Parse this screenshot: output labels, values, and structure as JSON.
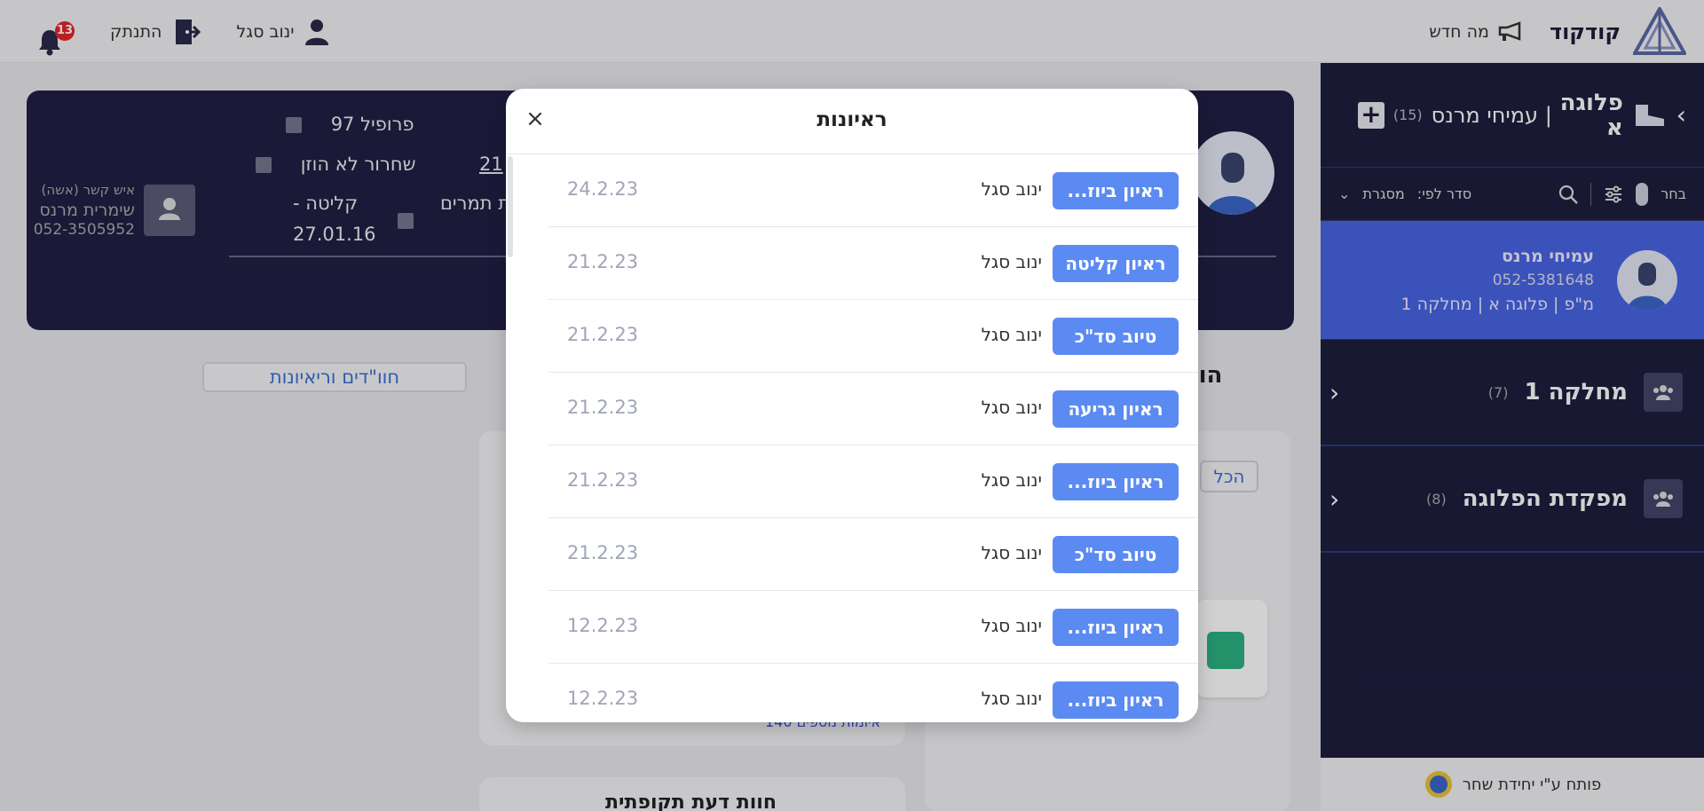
{
  "topbar": {
    "brand_name": "קודקוד",
    "whats_new": "מה חדש",
    "user_name": "ינוב סגל",
    "logout": "התנתק",
    "notifications_count": "13"
  },
  "sidebar": {
    "title": "פלוגה א",
    "separator_name": "| עמיחי מרנס",
    "count": "(15)",
    "toolbar": {
      "select": "בחר",
      "sort_by": "סדר לפי:",
      "sort_value": "מסגרת"
    },
    "selected_person": {
      "name": "עמיחי מרנס",
      "phone": "052-5381648",
      "role": "מ\"פ | פלוגה א | מחלקה 1"
    },
    "groups": [
      {
        "name": "מחלקה 1",
        "count": "(7)"
      },
      {
        "name": "מפקדת הפלוגה",
        "count": "(8)"
      }
    ],
    "footer": "פותח ע\"י יחידת שחר"
  },
  "profile_card": {
    "profile": "פרופיל 97",
    "discharge": "שחרור לא הוזן",
    "intake": "קליטה -",
    "intake_date": "27.01.16",
    "truncated_value": "21",
    "truncated_label": "ת תמרים",
    "contact_label": "איש קשר (אשה)",
    "contact_name": "שימרית מרנס",
    "contact_phone": "052-3505952"
  },
  "main": {
    "tab_label": "חוו\"דים וריאיונות",
    "heading_partial": "הודע",
    "all_filter": "הכל",
    "more_link": "140 איומות נוספים",
    "bottom_title": "חוות דעת תקופתית"
  },
  "modal": {
    "title": "ראיונות",
    "close_label": "×",
    "rows": [
      {
        "type": "ראיון ביוז...",
        "by": "ינוב סגל",
        "date": "24.2.23"
      },
      {
        "type": "ראיון קליטה",
        "by": "ינוב סגל",
        "date": "21.2.23"
      },
      {
        "type": "טיוב סד\"כ",
        "by": "ינוב סגל",
        "date": "21.2.23"
      },
      {
        "type": "ראיון גריעה",
        "by": "ינוב סגל",
        "date": "21.2.23"
      },
      {
        "type": "ראיון ביוז...",
        "by": "ינוב סגל",
        "date": "21.2.23"
      },
      {
        "type": "טיוב סד\"כ",
        "by": "ינוב סגל",
        "date": "21.2.23"
      },
      {
        "type": "ראיון ביוז...",
        "by": "ינוב סגל",
        "date": "12.2.23"
      },
      {
        "type": "ראיון ביוז...",
        "by": "ינוב סגל",
        "date": "12.2.23"
      }
    ]
  },
  "colors": {
    "sidebar_bg": "#1f1e3f",
    "accent_blue": "#4865e5",
    "badge_blue": "#5b8bf2",
    "notification_red": "#e5252a"
  }
}
